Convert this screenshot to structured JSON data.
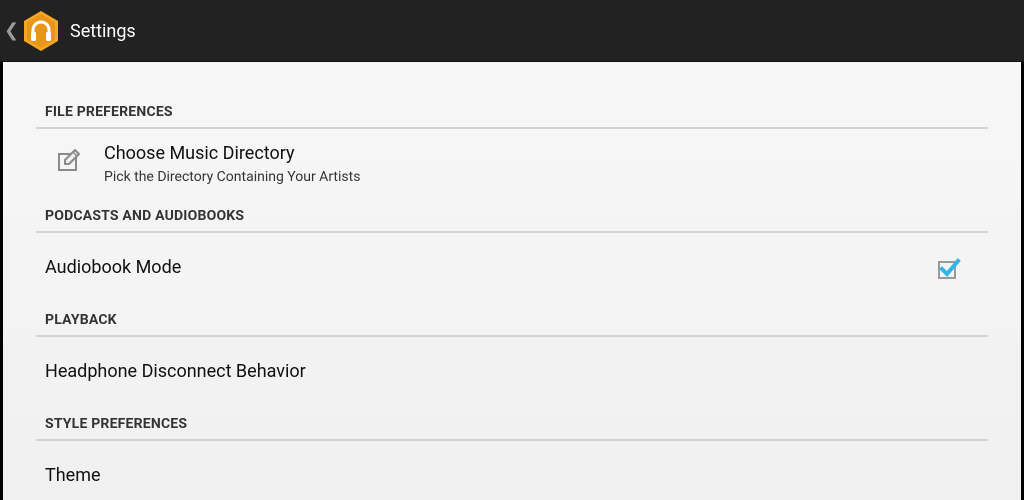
{
  "actionbar": {
    "title": "Settings",
    "app_icon": "headphones-icon",
    "up_icon": "chevron-left-icon",
    "bg_color": "#222222",
    "icon_color": "#F5A623"
  },
  "categories": [
    {
      "label": "FILE PREFERENCES"
    },
    {
      "label": "PODCASTS AND AUDIOBOOKS"
    },
    {
      "label": "PLAYBACK"
    },
    {
      "label": "STYLE PREFERENCES"
    }
  ],
  "prefs": {
    "music_directory": {
      "title": "Choose Music Directory",
      "summary": "Pick the Directory Containing Your Artists",
      "icon": "edit-icon"
    },
    "audiobook_mode": {
      "title": "Audiobook Mode",
      "checked": true,
      "check_color": "#33B5E5"
    },
    "headphone_disconnect": {
      "title": "Headphone Disconnect Behavior"
    },
    "theme": {
      "title": "Theme"
    }
  }
}
